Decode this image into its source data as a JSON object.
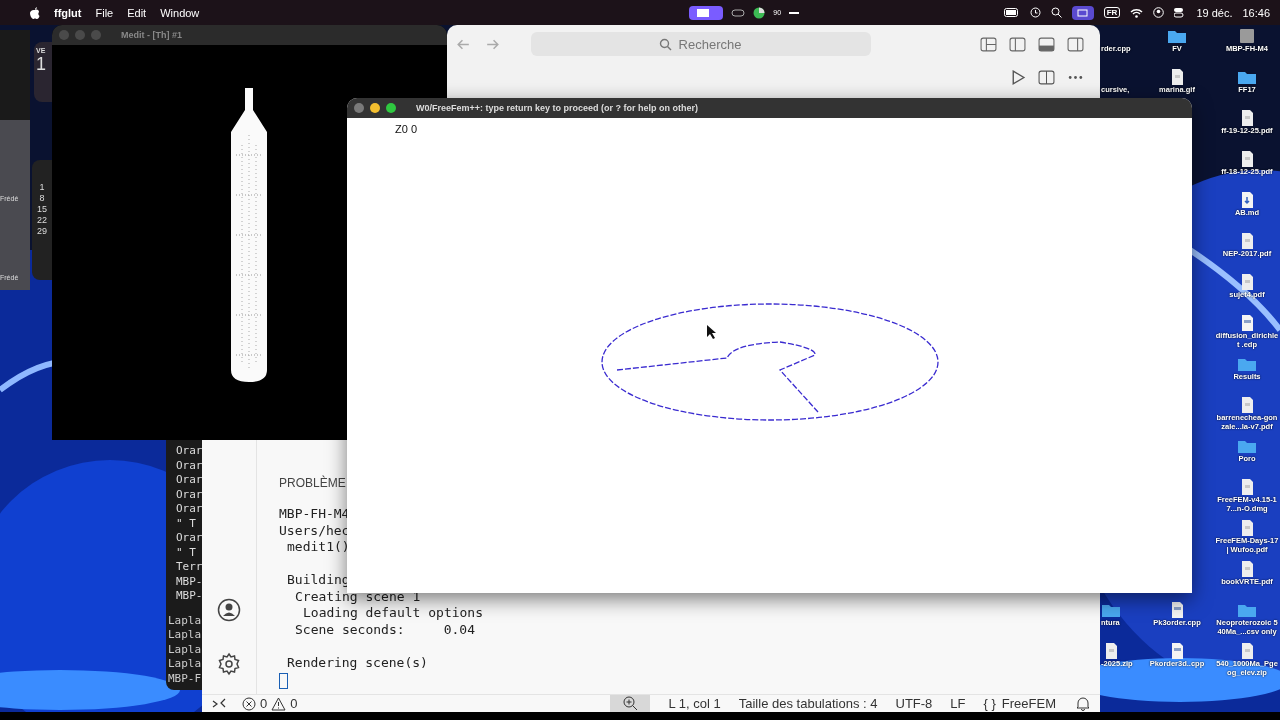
{
  "menu_bar": {
    "app": "ffglut",
    "menus": [
      "File",
      "Edit",
      "Window"
    ],
    "battery_reading": "90",
    "input_source": "FR",
    "date": "19 déc.",
    "time": "16:46"
  },
  "left_widgets": {
    "day": "VE",
    "date": "1",
    "calendar_days": [
      "1",
      "8",
      "15",
      "22",
      "29"
    ],
    "names": [
      "Frédé",
      "Frédé"
    ]
  },
  "browser_window": {
    "search_placeholder": "Recherche"
  },
  "medit_window": {
    "title": "Medit - [Th] #1",
    "active": false
  },
  "terminal": {
    "lines": [
      "Orar",
      "Orar",
      "Orar",
      "Orar",
      "Orar",
      "\" T",
      "Orar",
      "\" T",
      "Terr",
      "MBP-",
      "MBP-"
    ],
    "lower_lines": [
      "Lapla",
      "Lapla",
      "Lapla",
      "Lapla",
      "MBP-F"
    ]
  },
  "editor_window": {
    "panel_tab": "PROBLÈME",
    "terminal_lines": [
      {
        "text": "MBP-FH-M4"
      },
      {
        "text": "Users/hec",
        "children": [
          {
            "text": "medit1()"
          },
          {
            "text": "Building",
            "children": [
              {
                "text": "Creating scene 1",
                "children": [
                  {
                    "text": "Loading default options"
                  }
                ]
              },
              {
                "text": "Scene seconds:     0.04"
              }
            ]
          },
          {
            "text": "Rendering scene(s)"
          }
        ]
      }
    ],
    "status_bar": {
      "errors": "0",
      "warnings": "0",
      "items": [
        "L 1, col 1",
        "Taille des tabulations : 4",
        "UTF-8",
        "LF"
      ],
      "language_icon": "{ }",
      "language": "FreeFEM"
    }
  },
  "plot_window": {
    "title": "W0/FreeFem++: type return key to proceed (or ? for help on other)",
    "active": true,
    "label": "Z0 0"
  },
  "desktop": {
    "right_column": [
      {
        "label": "MBP-FH-M4",
        "kind": "disk"
      },
      {
        "label": "FF17",
        "kind": "folder"
      },
      {
        "label": "ff-19-12-25.pdf",
        "kind": "file"
      },
      {
        "label": "ff-18-12-25.pdf",
        "kind": "file"
      },
      {
        "label": "AB.md",
        "kind": "markdown"
      },
      {
        "label": "NEP-2017.pdf",
        "kind": "file"
      },
      {
        "label": "sujet4.pdf",
        "kind": "file"
      },
      {
        "label": "diffusion_dirichlet .edp",
        "kind": "code"
      },
      {
        "label": "Results",
        "kind": "folder"
      },
      {
        "label": "barrenechea-gonzale...la-v7.pdf",
        "kind": "file"
      },
      {
        "label": "Poro",
        "kind": "folder"
      },
      {
        "label": "FreeFEM-v4.15-17...n-O.dmg",
        "kind": "file"
      },
      {
        "label": "FreeFEM-Days-17 | Wufoo.pdf",
        "kind": "file"
      },
      {
        "label": "bookVRTE.pdf",
        "kind": "file"
      },
      {
        "label": "Neoproterozoic 540Ma_...csv only",
        "kind": "folder"
      },
      {
        "label": "540_1000Ma_Pgeog_elev.zip",
        "kind": "file"
      }
    ],
    "middle_column_top": [
      {
        "label": "FV",
        "kind": "folder"
      },
      {
        "label": "marina.gif",
        "kind": "file"
      }
    ],
    "middle_column_bottom": [
      {
        "label": "Pk3order.cpp",
        "kind": "code"
      },
      {
        "label": "Pkorder3d..cpp",
        "kind": "code"
      }
    ],
    "partial_column_top": [
      {
        "label": "rder.cpp"
      },
      {
        "label": "cursive,"
      }
    ],
    "partial_column_bottom": [
      {
        "label": "ntura",
        "kind": "folder"
      },
      {
        "label": "-2025.zip",
        "kind": "file"
      }
    ]
  }
}
